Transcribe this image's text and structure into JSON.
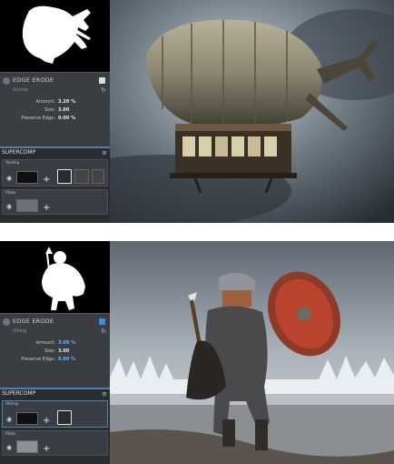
{
  "top": {
    "edge_erode": {
      "title": "EDGE ERODE",
      "subtitle": "Airship",
      "reset_icon": "↻",
      "rows": [
        {
          "label": "Amount:",
          "value": "3.20 %"
        },
        {
          "label": "Size:",
          "value": "3.00"
        },
        {
          "label": "Preserve Edge:",
          "value": "0.00 %"
        }
      ]
    },
    "supercomp": {
      "title": "SUPERCOMP",
      "menu_icon": "≡",
      "layers": [
        {
          "name": "Airship",
          "plus": "+"
        },
        {
          "name": "Plate",
          "plus": "+"
        }
      ]
    }
  },
  "bottom": {
    "edge_erode": {
      "title": "EDGE ERODE",
      "subtitle": "Viking",
      "reset_icon": "↻",
      "rows": [
        {
          "label": "Amount:",
          "value": "3.00 %"
        },
        {
          "label": "Size:",
          "value": "3.00"
        },
        {
          "label": "Preserve Edge:",
          "value": "0.00 %"
        }
      ]
    },
    "supercomp": {
      "title": "SUPERCOMP",
      "menu_icon": "≡",
      "layers": [
        {
          "name": "Viking",
          "plus": "+"
        },
        {
          "name": "Plate",
          "plus": "+"
        }
      ]
    }
  },
  "colors": {
    "panel": "#2d2f33",
    "accent": "#4d80b5",
    "value_blue": "#6fb2ff"
  }
}
